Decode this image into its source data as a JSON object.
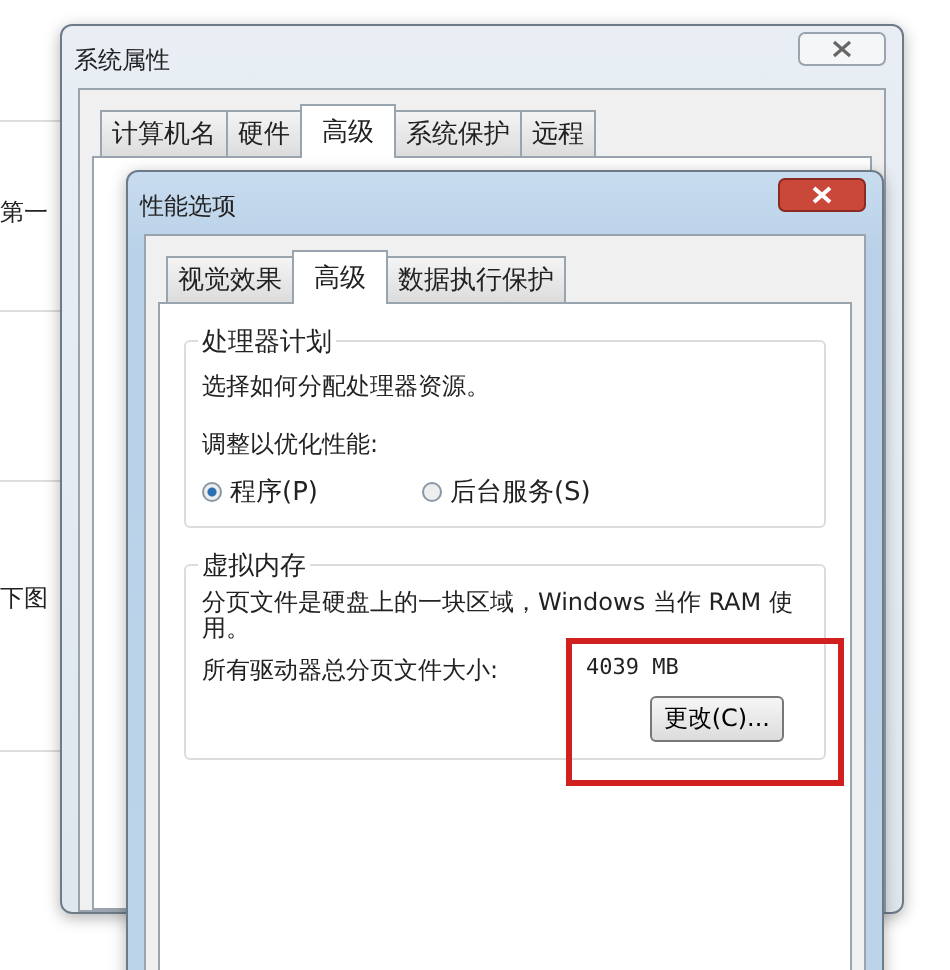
{
  "background": {
    "texts": [
      "第一",
      "下图"
    ]
  },
  "system_properties": {
    "title": "系统属性",
    "tabs": [
      {
        "label": "计算机名",
        "selected": false
      },
      {
        "label": "硬件",
        "selected": false
      },
      {
        "label": "高级",
        "selected": true
      },
      {
        "label": "系统保护",
        "selected": false
      },
      {
        "label": "远程",
        "selected": false
      }
    ]
  },
  "performance_options": {
    "title": "性能选项",
    "tabs": [
      {
        "label": "视觉效果",
        "selected": false
      },
      {
        "label": "高级",
        "selected": true
      },
      {
        "label": "数据执行保护",
        "selected": false
      }
    ],
    "processor_scheduling": {
      "title": "处理器计划",
      "description": "选择如何分配处理器资源。",
      "prompt": "调整以优化性能:",
      "options": [
        {
          "label": "程序(P)",
          "selected": true
        },
        {
          "label": "后台服务(S)",
          "selected": false
        }
      ]
    },
    "virtual_memory": {
      "title": "虚拟内存",
      "description": "分页文件是硬盘上的一块区域，Windows 当作 RAM 使用。",
      "total_label": "所有驱动器总分页文件大小:",
      "total_value": "4039 MB",
      "change_button": "更改(C)..."
    }
  }
}
